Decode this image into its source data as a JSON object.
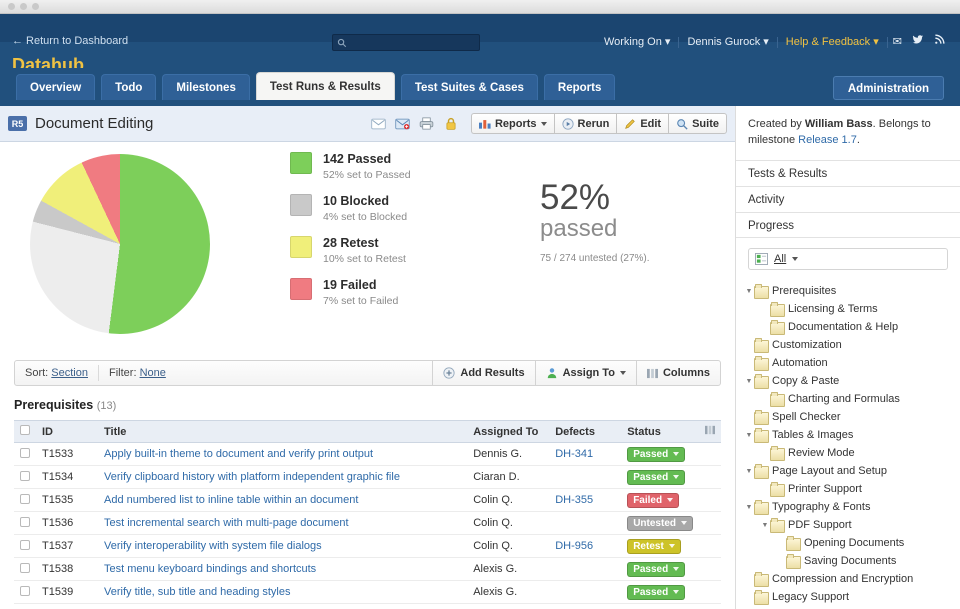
{
  "window": {
    "dots": 3
  },
  "header": {
    "return_label": "← Return to Dashboard",
    "brand": "Datahub",
    "search_placeholder": "",
    "search_value": "",
    "nav": [
      {
        "label": "Working On",
        "caret": true,
        "accent": false
      },
      {
        "label": "Dennis Gurock",
        "caret": true,
        "accent": false
      },
      {
        "label": "Help & Feedback",
        "caret": true,
        "accent": true
      }
    ],
    "social_icons": [
      "mail-icon",
      "twitter-icon",
      "rss-icon"
    ],
    "admin_label": "Administration"
  },
  "tabs": [
    {
      "label": "Overview",
      "active": false
    },
    {
      "label": "Todo",
      "active": false
    },
    {
      "label": "Milestones",
      "active": false
    },
    {
      "label": "Test Runs & Results",
      "active": true
    },
    {
      "label": "Test Suites & Cases",
      "active": false
    },
    {
      "label": "Reports",
      "active": false
    }
  ],
  "run": {
    "badge": "R5",
    "title": "Document Editing",
    "icon_buttons": [
      "envelope-icon",
      "envelope-add-icon",
      "printer-icon",
      "lock-icon"
    ],
    "tools": [
      {
        "label": "Reports",
        "icon": "bar-chart-icon",
        "caret": true
      },
      {
        "label": "Rerun",
        "icon": "play-icon",
        "caret": false
      },
      {
        "label": "Edit",
        "icon": "pencil-icon",
        "caret": false
      },
      {
        "label": "Suite",
        "icon": "magnifier-icon",
        "caret": false
      }
    ]
  },
  "chart_data": {
    "type": "pie",
    "title": "",
    "categories": [
      "Passed",
      "Untested",
      "Blocked",
      "Retest",
      "Failed"
    ],
    "values": [
      142,
      75,
      10,
      28,
      19
    ],
    "percents": [
      52,
      27,
      4,
      10,
      7
    ],
    "colors": [
      "#7dcf5a",
      "#ededed",
      "#c9c9c9",
      "#f0ef7a",
      "#f07b81"
    ],
    "total": 274,
    "legend_position": "right",
    "legend": [
      {
        "count": "142 Passed",
        "sub": "52% set to Passed",
        "color": "#7dcf5a"
      },
      {
        "count": "10 Blocked",
        "sub": "4% set to Blocked",
        "color": "#c9c9c9"
      },
      {
        "count": "28 Retest",
        "sub": "10% set to Retest",
        "color": "#f0ef7a"
      },
      {
        "count": "19 Failed",
        "sub": "7% set to Failed",
        "color": "#f07b81"
      }
    ],
    "summary": {
      "percent": "52%",
      "word": "passed",
      "note": "75 / 274 untested (27%)."
    }
  },
  "filter_bar": {
    "sort_label": "Sort:",
    "sort_value": "Section",
    "filter_label": "Filter:",
    "filter_value": "None",
    "actions": [
      {
        "label": "Add Results",
        "icon": "plus-circle-icon",
        "caret": false
      },
      {
        "label": "Assign To",
        "icon": "user-icon",
        "caret": true
      },
      {
        "label": "Columns",
        "icon": "columns-icon",
        "caret": false
      }
    ]
  },
  "section": {
    "name": "Prerequisites",
    "count": "(13)"
  },
  "table": {
    "columns": [
      "ID",
      "Title",
      "Assigned To",
      "Defects",
      "Status"
    ],
    "rows": [
      {
        "id": "T1533",
        "title": "Apply built-in theme to document and verify print output",
        "assignee": "Dennis G.",
        "defect": "DH-341",
        "status": "Passed",
        "status_color": "#63bb52"
      },
      {
        "id": "T1534",
        "title": "Verify clipboard history with platform independent graphic file",
        "assignee": "Ciaran D.",
        "defect": "",
        "status": "Passed",
        "status_color": "#63bb52"
      },
      {
        "id": "T1535",
        "title": "Add numbered list to inline table within an document",
        "assignee": "Colin Q.",
        "defect": "DH-355",
        "status": "Failed",
        "status_color": "#e0636a"
      },
      {
        "id": "T1536",
        "title": "Test incremental search with multi-page document",
        "assignee": "Colin Q.",
        "defect": "",
        "status": "Untested",
        "status_color": "#a8a8a8"
      },
      {
        "id": "T1537",
        "title": "Verify interoperability with system file dialogs",
        "assignee": "Colin Q.",
        "defect": "DH-956",
        "status": "Retest",
        "status_color": "#cdc328"
      },
      {
        "id": "T1538",
        "title": "Test menu keyboard bindings and shortcuts",
        "assignee": "Alexis G.",
        "defect": "",
        "status": "Passed",
        "status_color": "#63bb52"
      },
      {
        "id": "T1539",
        "title": "Verify title, sub title and heading styles",
        "assignee": "Alexis G.",
        "defect": "",
        "status": "Passed",
        "status_color": "#63bb52"
      }
    ]
  },
  "sidebar": {
    "description_prefix": "Created by ",
    "description_author": "William Bass",
    "description_middle": ". Belongs to milestone ",
    "description_milestone": "Release 1.7",
    "description_suffix": ".",
    "sections": [
      {
        "label": "Tests & Results"
      },
      {
        "label": "Activity"
      },
      {
        "label": "Progress"
      }
    ],
    "filter": {
      "icon": "grid-filter-icon",
      "label": "All",
      "caret": true
    },
    "tree": [
      {
        "label": "Prerequisites",
        "depth": 0,
        "expandable": true,
        "expanded": true
      },
      {
        "label": "Licensing & Terms",
        "depth": 1,
        "expandable": false,
        "expanded": false
      },
      {
        "label": "Documentation & Help",
        "depth": 1,
        "expandable": false,
        "expanded": false
      },
      {
        "label": "Customization",
        "depth": 0,
        "expandable": false,
        "expanded": false
      },
      {
        "label": "Automation",
        "depth": 0,
        "expandable": false,
        "expanded": false
      },
      {
        "label": "Copy & Paste",
        "depth": 0,
        "expandable": true,
        "expanded": true
      },
      {
        "label": "Charting and Formulas",
        "depth": 1,
        "expandable": false,
        "expanded": false
      },
      {
        "label": "Spell Checker",
        "depth": 0,
        "expandable": false,
        "expanded": false
      },
      {
        "label": "Tables & Images",
        "depth": 0,
        "expandable": true,
        "expanded": true
      },
      {
        "label": "Review Mode",
        "depth": 1,
        "expandable": false,
        "expanded": false
      },
      {
        "label": "Page Layout and Setup",
        "depth": 0,
        "expandable": true,
        "expanded": true
      },
      {
        "label": "Printer Support",
        "depth": 1,
        "expandable": false,
        "expanded": false
      },
      {
        "label": "Typography & Fonts",
        "depth": 0,
        "expandable": true,
        "expanded": true
      },
      {
        "label": "PDF Support",
        "depth": 1,
        "expandable": true,
        "expanded": true
      },
      {
        "label": "Opening Documents",
        "depth": 2,
        "expandable": false,
        "expanded": false
      },
      {
        "label": "Saving Documents",
        "depth": 2,
        "expandable": false,
        "expanded": false
      },
      {
        "label": "Compression and Encryption",
        "depth": 0,
        "expandable": false,
        "expanded": false
      },
      {
        "label": "Legacy Support",
        "depth": 0,
        "expandable": false,
        "expanded": false
      }
    ]
  }
}
